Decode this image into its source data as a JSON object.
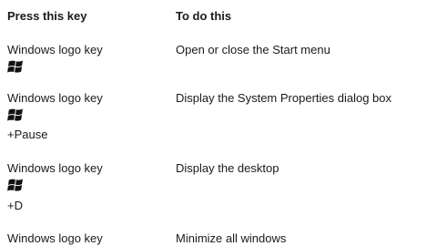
{
  "table": {
    "headers": {
      "key": "Press this key",
      "action": "To do this"
    },
    "rows": [
      {
        "key_text": "Windows logo key",
        "logo_icon": "windows-logo-icon",
        "key_suffix": "",
        "action": "Open or close the Start menu"
      },
      {
        "key_text": "Windows logo key",
        "logo_icon": "windows-logo-icon",
        "key_suffix": "+Pause",
        "action": "Display the System Properties dialog box"
      },
      {
        "key_text": "Windows logo key",
        "logo_icon": "windows-logo-icon",
        "key_suffix": "+D",
        "action": "Display the desktop"
      },
      {
        "key_text": "Windows logo key",
        "logo_icon": "windows-logo-icon",
        "key_suffix": "",
        "action": "Minimize all windows"
      }
    ]
  }
}
